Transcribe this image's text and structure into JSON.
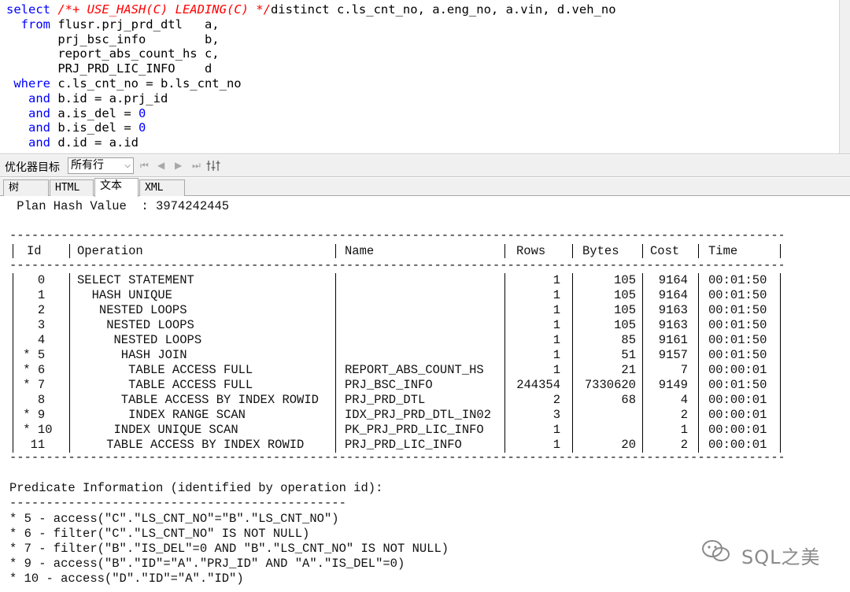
{
  "editor": {
    "lines": [
      {
        "kw": "select ",
        "cm": "/*+ USE_HASH(C) LEADING(C) */",
        "rest": "distinct c.ls_cnt_no, a.eng_no, a.vin, d.veh_no"
      },
      {
        "kw": "  from ",
        "cm": "",
        "rest": "flusr.prj_prd_dtl   a,"
      },
      {
        "kw": "",
        "cm": "",
        "rest": "       prj_bsc_info        b,"
      },
      {
        "kw": "",
        "cm": "",
        "rest": "       report_abs_count_hs c,"
      },
      {
        "kw": "",
        "cm": "",
        "rest": "       PRJ_PRD_LIC_INFO    d"
      },
      {
        "kw": " where ",
        "cm": "",
        "rest": "c.ls_cnt_no = b.ls_cnt_no"
      },
      {
        "kw": "   and ",
        "cm": "",
        "rest": "b.id = a.prj_id"
      },
      {
        "kw": "   and ",
        "cm": "",
        "rest": "a.is_del = ",
        "num": "0"
      },
      {
        "kw": "   and ",
        "cm": "",
        "rest": "b.is_del = ",
        "num": "0"
      },
      {
        "kw": "   and ",
        "cm": "",
        "rest": "d.id = a.id"
      }
    ]
  },
  "toolbar": {
    "label": "优化器目标",
    "select_value": "所有行",
    "nav": [
      "first-icon",
      "prev-icon",
      "next-icon",
      "last-icon"
    ]
  },
  "tabs": [
    {
      "label": "树",
      "active": false
    },
    {
      "label": "HTML",
      "active": false
    },
    {
      "label": "文本",
      "active": true
    },
    {
      "label": "XML",
      "active": false
    }
  ],
  "plan": {
    "hash_line": " Plan Hash Value  : 3974242445",
    "headers": {
      "id": "Id",
      "operation": "Operation",
      "name": "Name",
      "rows": "Rows",
      "bytes": "Bytes",
      "cost": "Cost",
      "time": "Time"
    },
    "rows": [
      {
        "id": "   0",
        "op": "SELECT STATEMENT",
        "name": "",
        "rows": "1",
        "bytes": "105",
        "cost": "9164",
        "time": "00:01:50"
      },
      {
        "id": "   1",
        "op": "  HASH UNIQUE",
        "name": "",
        "rows": "1",
        "bytes": "105",
        "cost": "9164",
        "time": "00:01:50"
      },
      {
        "id": "   2",
        "op": "   NESTED LOOPS",
        "name": "",
        "rows": "1",
        "bytes": "105",
        "cost": "9163",
        "time": "00:01:50"
      },
      {
        "id": "   3",
        "op": "    NESTED LOOPS",
        "name": "",
        "rows": "1",
        "bytes": "105",
        "cost": "9163",
        "time": "00:01:50"
      },
      {
        "id": "   4",
        "op": "     NESTED LOOPS",
        "name": "",
        "rows": "1",
        "bytes": "85",
        "cost": "9161",
        "time": "00:01:50"
      },
      {
        "id": " * 5",
        "op": "      HASH JOIN",
        "name": "",
        "rows": "1",
        "bytes": "51",
        "cost": "9157",
        "time": "00:01:50"
      },
      {
        "id": " * 6",
        "op": "       TABLE ACCESS FULL",
        "name": "REPORT_ABS_COUNT_HS",
        "rows": "1",
        "bytes": "21",
        "cost": "7",
        "time": "00:00:01"
      },
      {
        "id": " * 7",
        "op": "       TABLE ACCESS FULL",
        "name": "PRJ_BSC_INFO",
        "rows": "244354",
        "bytes": "7330620",
        "cost": "9149",
        "time": "00:01:50"
      },
      {
        "id": "   8",
        "op": "      TABLE ACCESS BY INDEX ROWID",
        "name": "PRJ_PRD_DTL",
        "rows": "2",
        "bytes": "68",
        "cost": "4",
        "time": "00:00:01"
      },
      {
        "id": " * 9",
        "op": "       INDEX RANGE SCAN",
        "name": "IDX_PRJ_PRD_DTL_IN02",
        "rows": "3",
        "bytes": "",
        "cost": "2",
        "time": "00:00:01"
      },
      {
        "id": " * 10",
        "op": "     INDEX UNIQUE SCAN",
        "name": "PK_PRJ_PRD_LIC_INFO",
        "rows": "1",
        "bytes": "",
        "cost": "1",
        "time": "00:00:01"
      },
      {
        "id": "  11",
        "op": "    TABLE ACCESS BY INDEX ROWID",
        "name": "PRJ_PRD_LIC_INFO",
        "rows": "1",
        "bytes": "20",
        "cost": "2",
        "time": "00:00:01"
      }
    ],
    "separator": "-----------------------------------------------------------------------------------------------------------------",
    "predicate_title": "Predicate Information (identified by operation id):",
    "predicate_underline": "----------------------------------------------",
    "predicates": [
      "* 5 - access(\"C\".\"LS_CNT_NO\"=\"B\".\"LS_CNT_NO\")",
      "* 6 - filter(\"C\".\"LS_CNT_NO\" IS NOT NULL)",
      "* 7 - filter(\"B\".\"IS_DEL\"=0 AND \"B\".\"LS_CNT_NO\" IS NOT NULL)",
      "* 9 - access(\"B\".\"ID\"=\"A\".\"PRJ_ID\" AND \"A\".\"IS_DEL\"=0)",
      "* 10 - access(\"D\".\"ID\"=\"A\".\"ID\")"
    ]
  },
  "watermark": "SQL之美"
}
